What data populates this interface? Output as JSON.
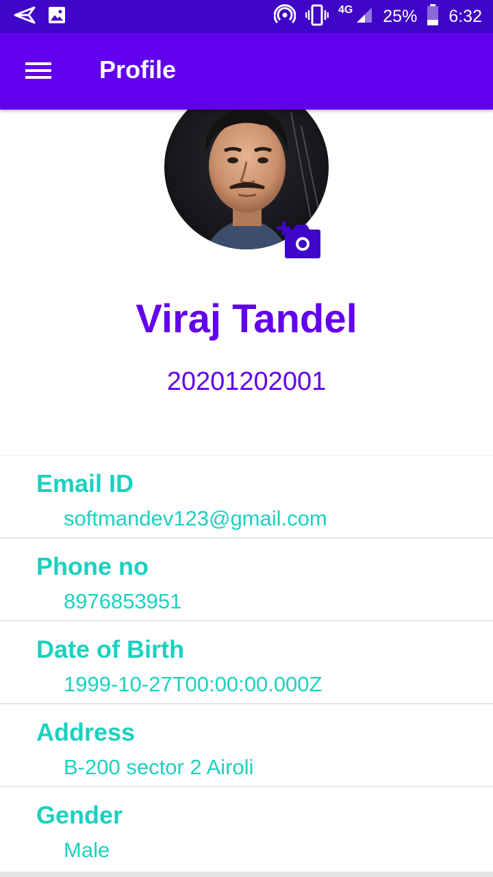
{
  "status_bar": {
    "network": "4G",
    "battery": "25%",
    "time": "6:32"
  },
  "app_bar": {
    "title": "Profile",
    "menu_icon": "hamburger-menu-icon"
  },
  "profile": {
    "name": "Viraj Tandel",
    "id": "20201202001",
    "change_photo_icon": "add-a-photo-icon"
  },
  "details": [
    {
      "label": "Email ID",
      "value": "softmandev123@gmail.com"
    },
    {
      "label": "Phone no",
      "value": "8976853951"
    },
    {
      "label": "Date of Birth",
      "value": "1999-10-27T00:00:00.000Z"
    },
    {
      "label": "Address",
      "value": "B-200 sector 2 Airoli"
    },
    {
      "label": "Gender",
      "value": "Male"
    }
  ],
  "colors": {
    "status_bar": "#3f06c7",
    "app_bar": "#6200ee",
    "accent_text": "#6200ee",
    "detail_text": "#1ad1c0"
  }
}
